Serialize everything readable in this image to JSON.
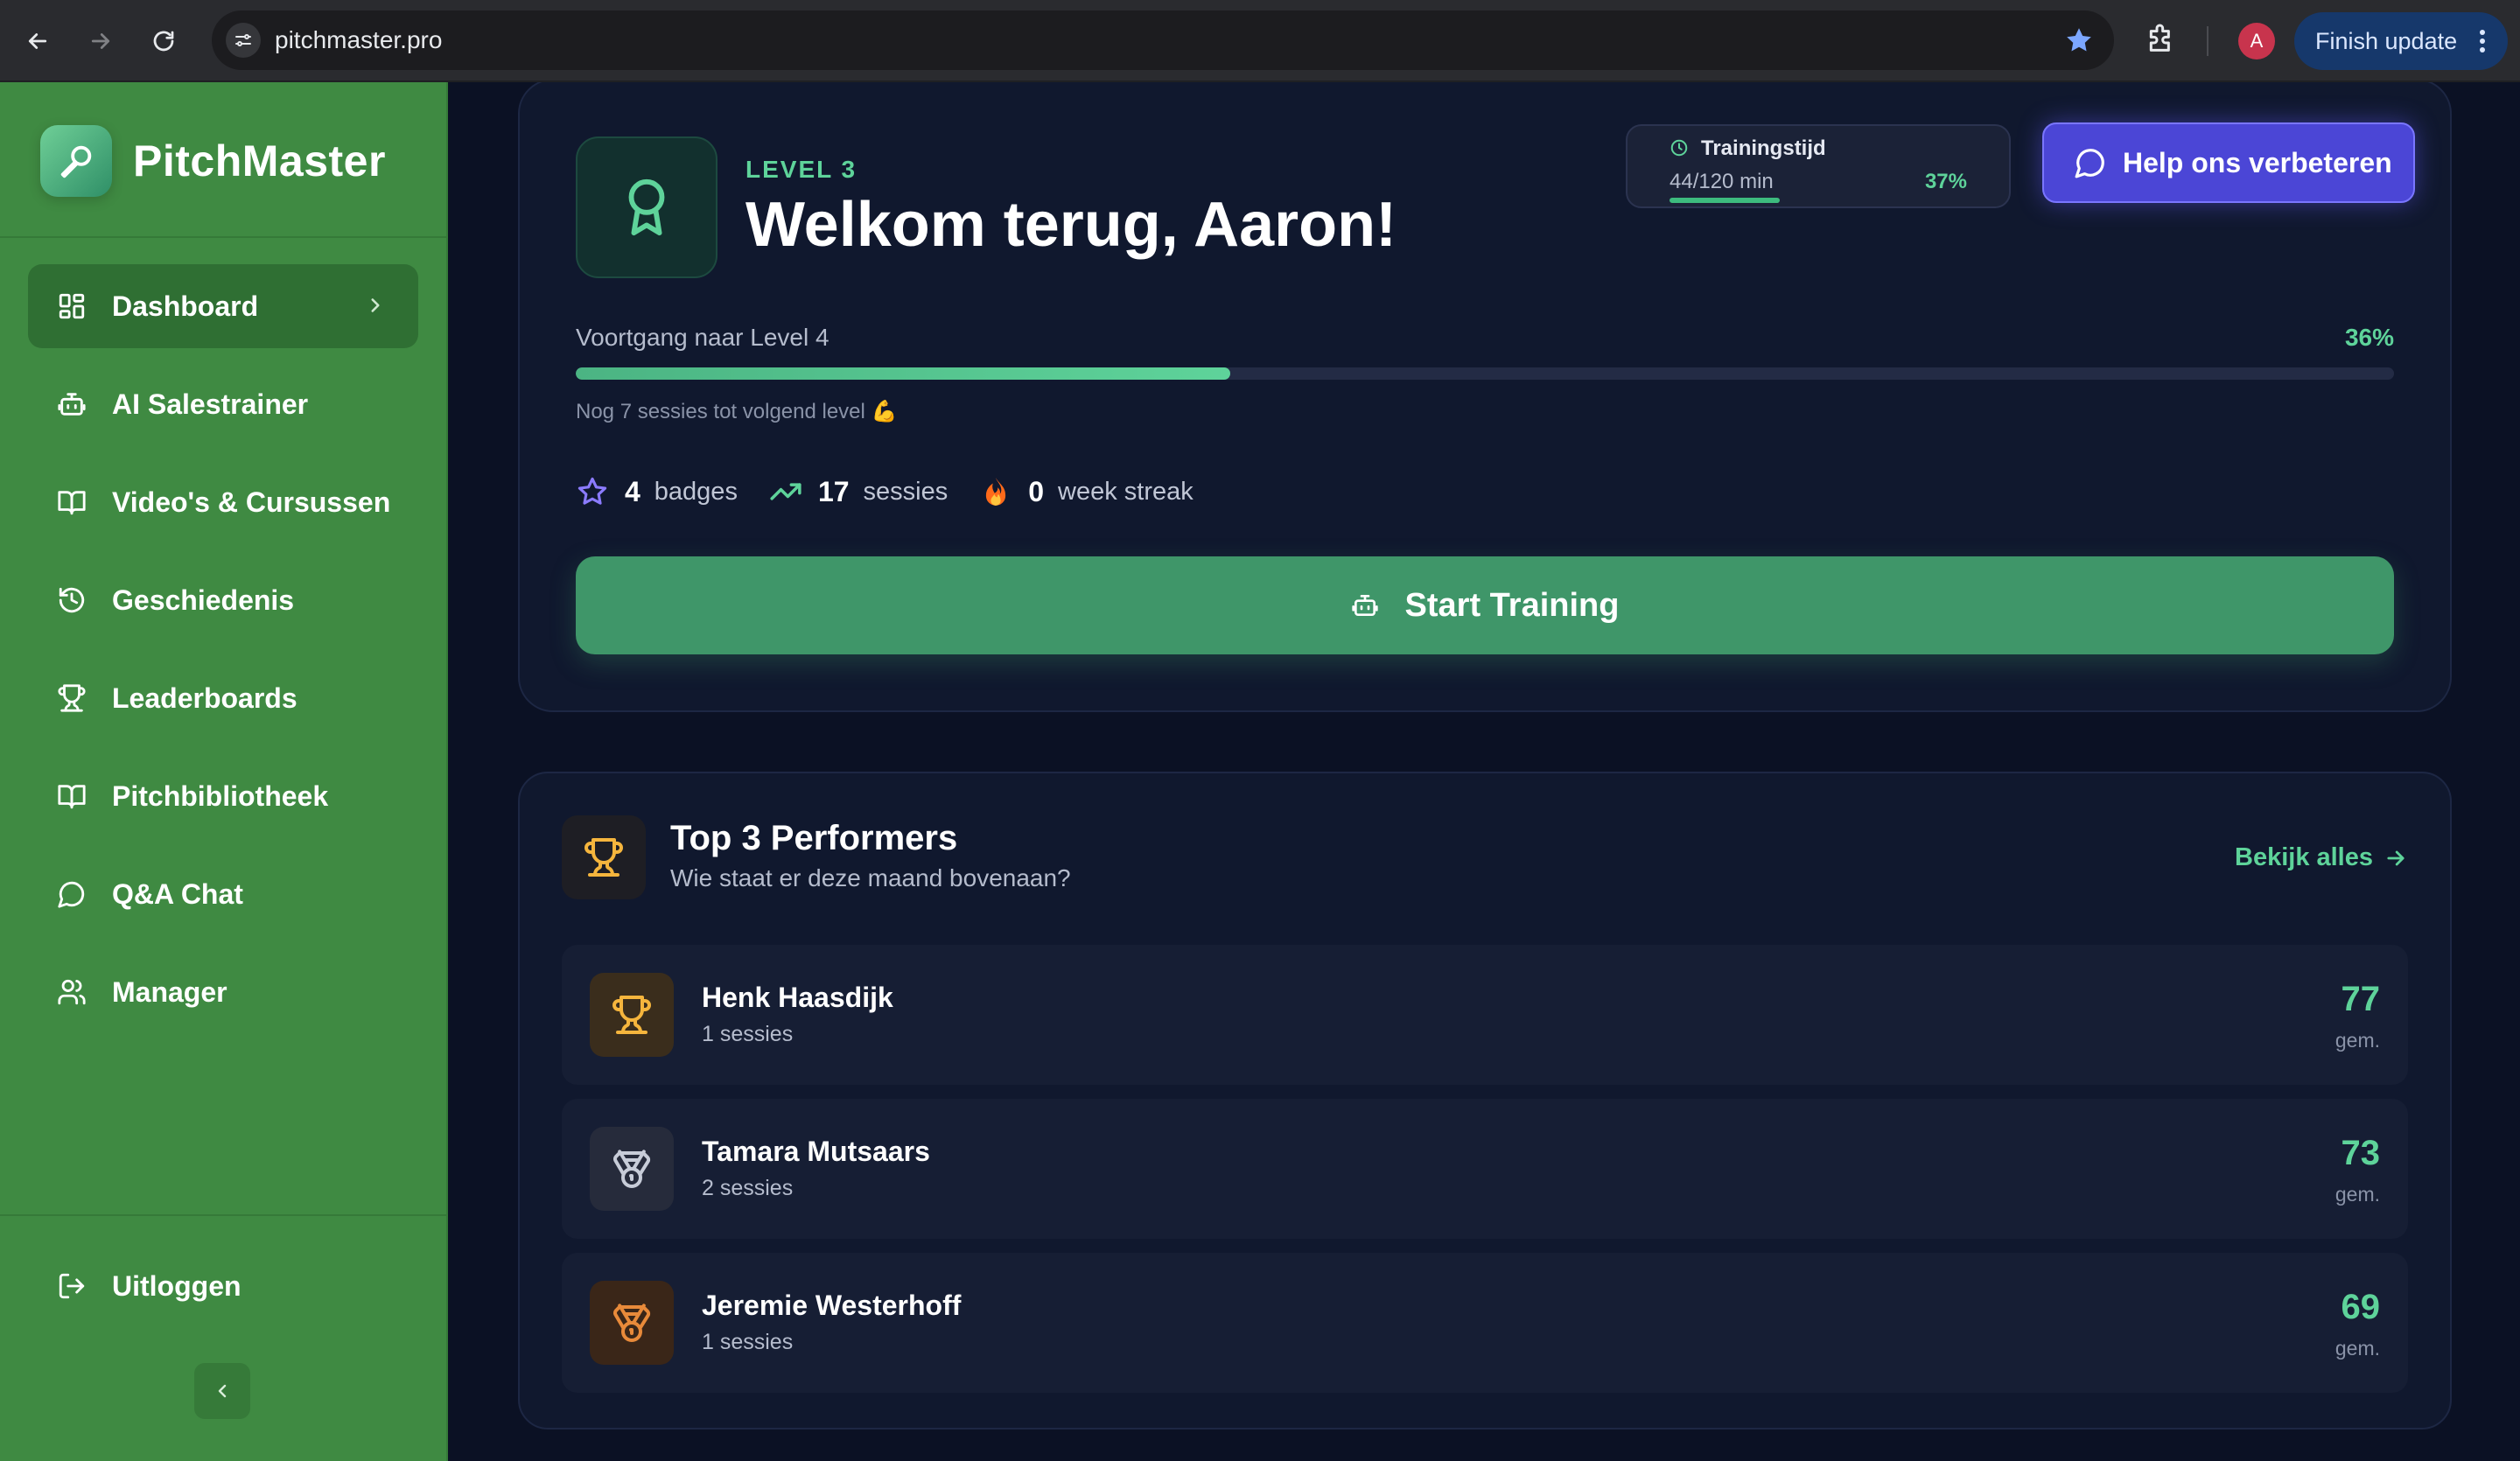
{
  "browser": {
    "url": "pitchmaster.pro",
    "profile_initial": "A",
    "finish_update_label": "Finish update"
  },
  "brand": {
    "name": "PitchMaster"
  },
  "sidebar": {
    "items": [
      {
        "label": "Dashboard",
        "icon": "dashboard-icon",
        "active": true
      },
      {
        "label": "AI Salestrainer",
        "icon": "bot-icon"
      },
      {
        "label": "Video's & Cursussen",
        "icon": "book-open-icon"
      },
      {
        "label": "Geschiedenis",
        "icon": "history-icon"
      },
      {
        "label": "Leaderboards",
        "icon": "trophy-icon"
      },
      {
        "label": "Pitchbibliotheek",
        "icon": "book-open-icon"
      },
      {
        "label": "Q&A Chat",
        "icon": "chat-bubble-icon"
      },
      {
        "label": "Manager",
        "icon": "users-icon"
      }
    ],
    "logout_label": "Uitloggen"
  },
  "hero": {
    "level_label": "LEVEL 3",
    "welcome": "Welkom terug, Aaron!",
    "training_time": {
      "label": "Trainingstijd",
      "value": "44/120 min",
      "percent": "37%"
    },
    "help_button": "Help ons verbeteren",
    "progress": {
      "label": "Voortgang naar Level 4",
      "percent_text": "36%",
      "percent": 36,
      "subtext": "Nog 7 sessies tot volgend level 💪"
    },
    "stats": [
      {
        "value": "4",
        "label": "badges",
        "icon": "star-icon"
      },
      {
        "value": "17",
        "label": "sessies",
        "icon": "trending-up-icon"
      },
      {
        "value": "0",
        "label": "week streak",
        "icon": "fire-icon"
      }
    ],
    "start_button": "Start Training"
  },
  "performers": {
    "title": "Top 3 Performers",
    "subtitle": "Wie staat er deze maand bovenaan?",
    "view_all": "Bekijk alles",
    "rows": [
      {
        "name": "Henk Haasdijk",
        "sessions": "1 sessies",
        "score": "77",
        "unit": "gem.",
        "icon": "trophy-icon",
        "color": "#f5b53d"
      },
      {
        "name": "Tamara Mutsaars",
        "sessions": "2 sessies",
        "score": "73",
        "unit": "gem.",
        "icon": "medal-icon",
        "color": "#c7ccd8"
      },
      {
        "name": "Jeremie Westerhoff",
        "sessions": "1 sessies",
        "score": "69",
        "unit": "gem.",
        "icon": "medal-icon",
        "color": "#e88a3a"
      }
    ]
  },
  "colors": {
    "accent_green": "#5ed39a",
    "sidebar_green": "#3f8a42",
    "help_purple": "#4b46d6",
    "start_green": "#3f9669"
  }
}
